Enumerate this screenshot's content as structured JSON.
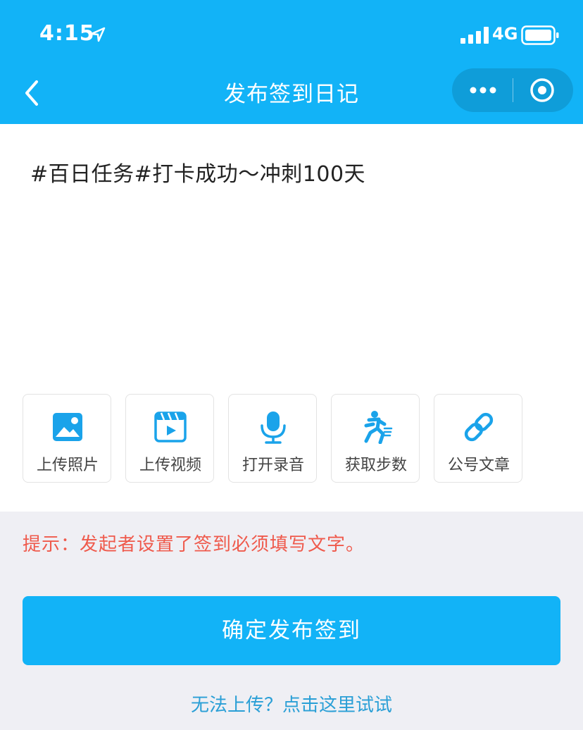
{
  "status": {
    "time": "4:15",
    "network": "4G"
  },
  "nav": {
    "title": "发布签到日记"
  },
  "diary": {
    "content": "#百日任务#打卡成功～冲刺100天"
  },
  "tools": [
    {
      "label": "上传照片",
      "icon": "image-icon"
    },
    {
      "label": "上传视频",
      "icon": "video-icon"
    },
    {
      "label": "打开录音",
      "icon": "microphone-icon"
    },
    {
      "label": "获取步数",
      "icon": "running-icon"
    },
    {
      "label": "公号文章",
      "icon": "link-icon"
    }
  ],
  "hint": "提示：发起者设置了签到必须填写文字。",
  "submit_label": "确定发布签到",
  "help_link": "无法上传？点击这里试试",
  "colors": {
    "brand": "#12b3f7",
    "hint": "#ef5a4c",
    "link": "#2a9fd6"
  }
}
